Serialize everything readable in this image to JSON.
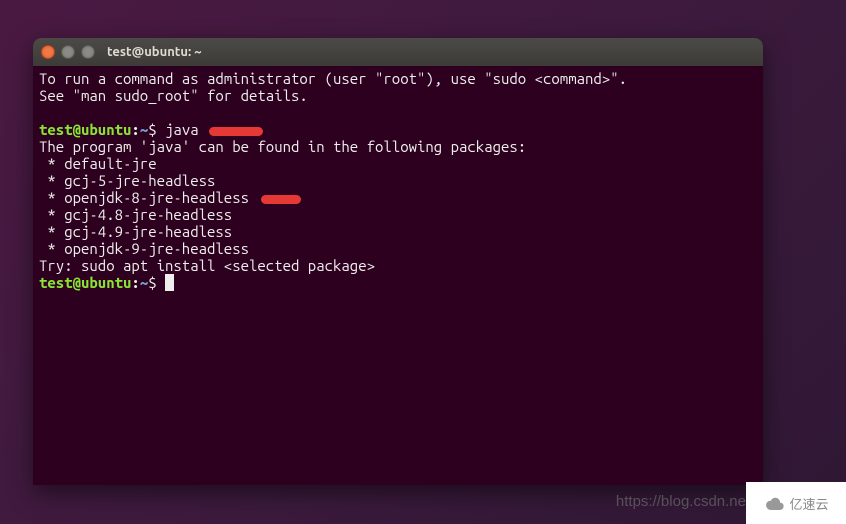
{
  "titlebar": {
    "title": "test@ubuntu: ~"
  },
  "terminal": {
    "intro_line1": "To run a command as administrator (user \"root\"), use \"sudo <command>\".",
    "intro_line2": "See \"man sudo_root\" for details.",
    "prompt1": {
      "user_host": "test@ubuntu",
      "colon": ":",
      "path": "~",
      "dollar": "$ ",
      "command": "java"
    },
    "output_header": "The program 'java' can be found in the following packages:",
    "packages": [
      " * default-jre",
      " * gcj-5-jre-headless",
      " * openjdk-8-jre-headless",
      " * gcj-4.8-jre-headless",
      " * gcj-4.9-jre-headless",
      " * openjdk-9-jre-headless"
    ],
    "try_line": "Try: sudo apt install <selected package>",
    "prompt2": {
      "user_host": "test@ubuntu",
      "colon": ":",
      "path": "~",
      "dollar": "$ "
    }
  },
  "watermark": {
    "url": "https://blog.csdn.ne",
    "logo_text": "亿速云"
  }
}
